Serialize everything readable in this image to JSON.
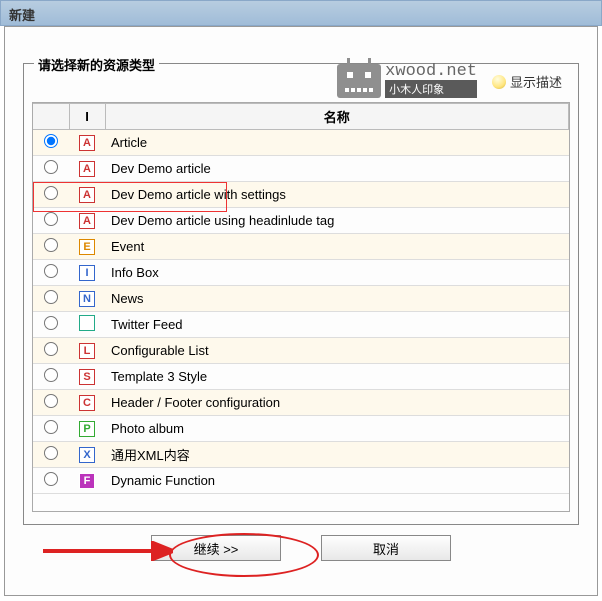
{
  "window": {
    "title": "新建"
  },
  "logo": {
    "text": "xwood.net",
    "subtitle": "小木人印象"
  },
  "fieldset": {
    "legend": "请选择新的资源类型"
  },
  "descLink": {
    "label": "显示描述"
  },
  "table": {
    "headers": {
      "icon": "I",
      "name": "名称"
    },
    "rows": [
      {
        "letter": "A",
        "iconClass": "ic-a",
        "label": "Article",
        "selected": true
      },
      {
        "letter": "A",
        "iconClass": "ic-a",
        "label": "Dev Demo article",
        "selected": false
      },
      {
        "letter": "A",
        "iconClass": "ic-a",
        "label": "Dev Demo article with settings",
        "selected": false
      },
      {
        "letter": "A",
        "iconClass": "ic-a",
        "label": "Dev Demo article using headinlude tag",
        "selected": false
      },
      {
        "letter": "E",
        "iconClass": "ic-e",
        "label": "Event",
        "selected": false
      },
      {
        "letter": "I",
        "iconClass": "ic-i",
        "label": "Info Box",
        "selected": false
      },
      {
        "letter": "N",
        "iconClass": "ic-n",
        "label": "News",
        "selected": false
      },
      {
        "letter": "",
        "iconClass": "ic-t",
        "label": "Twitter Feed",
        "selected": false
      },
      {
        "letter": "L",
        "iconClass": "ic-l",
        "label": "Configurable List",
        "selected": false
      },
      {
        "letter": "S",
        "iconClass": "ic-s",
        "label": "Template 3 Style",
        "selected": false
      },
      {
        "letter": "C",
        "iconClass": "ic-c",
        "label": "Header / Footer configuration",
        "selected": false
      },
      {
        "letter": "P",
        "iconClass": "ic-p",
        "label": "Photo album",
        "selected": false
      },
      {
        "letter": "X",
        "iconClass": "ic-x",
        "label": "通用XML内容",
        "selected": false
      },
      {
        "letter": "F",
        "iconClass": "ic-f",
        "label": "Dynamic Function",
        "selected": false
      }
    ]
  },
  "buttons": {
    "continue": "继续 >>",
    "cancel": "取消"
  }
}
